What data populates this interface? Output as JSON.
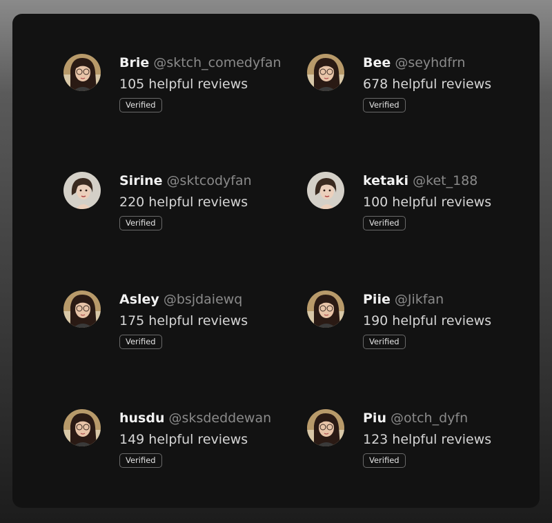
{
  "reviewers": [
    {
      "name": "Brie",
      "handle": "@sktch_comedyfan",
      "reviews": "105 helpful reviews",
      "badge": "Verified",
      "avatar_icon": "girl-glasses-avatar"
    },
    {
      "name": "Bee",
      "handle": "@seyhdfrn",
      "reviews": "678 helpful reviews",
      "badge": "Verified",
      "avatar_icon": "girl-glasses-avatar"
    },
    {
      "name": "Sirine",
      "handle": "@sktcodyfan",
      "reviews": "220 helpful reviews",
      "badge": "Verified",
      "avatar_icon": "short-hair-avatar"
    },
    {
      "name": "ketaki",
      "handle": "@ket_188",
      "reviews": "100 helpful reviews",
      "badge": "Verified",
      "avatar_icon": "short-hair-avatar"
    },
    {
      "name": "Asley",
      "handle": "@bsjdaiewq",
      "reviews": "175 helpful reviews",
      "badge": "Verified",
      "avatar_icon": "girl-glasses-avatar"
    },
    {
      "name": "Piie",
      "handle": "@Jikfan",
      "reviews": "190 helpful reviews",
      "badge": "Verified",
      "avatar_icon": "girl-glasses-avatar"
    },
    {
      "name": "husdu",
      "handle": "@sksdeddewan",
      "reviews": "149 helpful reviews",
      "badge": "Verified",
      "avatar_icon": "girl-glasses-avatar"
    },
    {
      "name": "Piu",
      "handle": "@otch_dyfn",
      "reviews": "123 helpful reviews",
      "badge": "Verified",
      "avatar_icon": "girl-glasses-avatar"
    }
  ],
  "colors": {
    "panel_bg": "#121212",
    "name": "#f2f2f2",
    "handle": "#8a8a8a",
    "reviews": "#d6d6d6",
    "badge_border": "#6a6a6a"
  }
}
